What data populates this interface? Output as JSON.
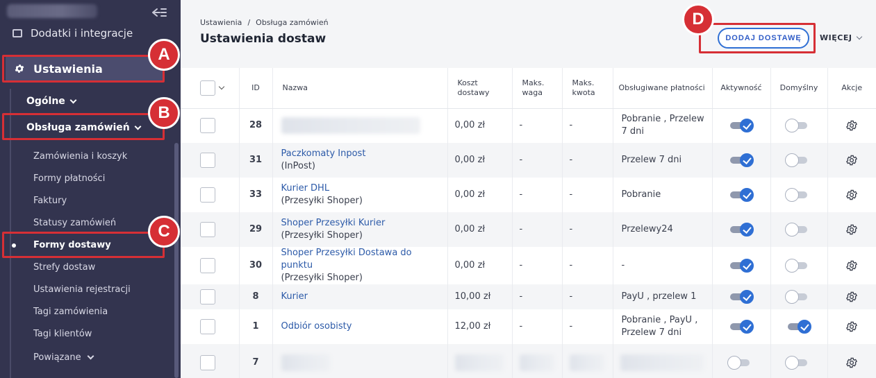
{
  "sidebar": {
    "addons_label": "Dodatki i integracje",
    "settings_label": "Ustawienia",
    "sub_general": "Ogólne",
    "sub_orders": "Obsługa zamówień",
    "leaves": [
      "Zamówienia i koszyk",
      "Formy płatności",
      "Faktury",
      "Statusy zamówień",
      "Formy dostawy",
      "Strefy dostaw",
      "Ustawienia rejestracji",
      "Tagi zamówienia",
      "Tagi klientów"
    ],
    "related_label": "Powiązane",
    "active_leaf": "Formy dostawy"
  },
  "annotations": {
    "a": "A",
    "b": "B",
    "c": "C",
    "d": "D"
  },
  "header": {
    "breadcrumb": [
      "Ustawienia",
      "/",
      "Obsługa zamówień"
    ],
    "title": "Ustawienia dostaw",
    "add_button": "DODAJ DOSTAWĘ",
    "more_button": "WIĘCEJ"
  },
  "table": {
    "columns": {
      "id": "ID",
      "name": "Nazwa",
      "cost": "Koszt dostawy",
      "max_weight": "Maks. waga",
      "max_amount": "Maks. kwota",
      "payments": "Obsługiwane płatności",
      "active": "Aktywność",
      "default": "Domyślny",
      "actions": "Akcje"
    },
    "rows": [
      {
        "id": "28",
        "name": "",
        "sub": "",
        "cost": "0,00 zł",
        "weight": "-",
        "amount": "-",
        "payments": "Pobranie , Przelew 7 dni"
      },
      {
        "id": "31",
        "name": "Paczkomaty Inpost",
        "sub": "(InPost)",
        "cost": "0,00 zł",
        "weight": "-",
        "amount": "-",
        "payments": "Przelew 7 dni"
      },
      {
        "id": "33",
        "name": "Kurier DHL",
        "sub": "(Przesyłki Shoper)",
        "cost": "0,00 zł",
        "weight": "-",
        "amount": "-",
        "payments": "Pobranie"
      },
      {
        "id": "29",
        "name": "Shoper Przesyłki Kurier",
        "sub": "(Przesyłki Shoper)",
        "cost": "0,00 zł",
        "weight": "-",
        "amount": "-",
        "payments": "Przelewy24"
      },
      {
        "id": "30",
        "name": "Shoper Przesyłki Dostawa do punktu",
        "sub": "(Przesyłki Shoper)",
        "cost": "0,00 zł",
        "weight": "-",
        "amount": "-",
        "payments": "-"
      },
      {
        "id": "8",
        "name": "Kurier",
        "sub": "",
        "cost": "10,00 zł",
        "weight": "-",
        "amount": "-",
        "payments": "PayU , przelew 1"
      },
      {
        "id": "1",
        "name": "Odbiór osobisty",
        "sub": "",
        "cost": "12,00 zł",
        "weight": "-",
        "amount": "-",
        "payments": "Pobranie , PayU , Przelew 7 dni"
      },
      {
        "id": "7",
        "name": "",
        "sub": "",
        "cost": "",
        "weight": "",
        "amount": "",
        "payments": ""
      }
    ],
    "active_states": [
      true,
      true,
      true,
      true,
      true,
      true,
      true,
      false
    ],
    "default_states": [
      false,
      false,
      false,
      false,
      false,
      false,
      true,
      false
    ]
  },
  "colors": {
    "sidebar_bg": "#33344f",
    "accent_blue": "#2f6fd4",
    "annotation_red": "#d62f35",
    "link_blue": "#2c5aa8"
  }
}
